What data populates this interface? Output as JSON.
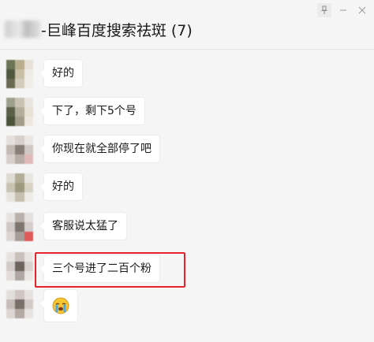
{
  "header": {
    "title": "-巨峰百度搜索祛斑 (7)"
  },
  "messages": [
    {
      "text": "好的"
    },
    {
      "text": "下了，剩下5个号"
    },
    {
      "text": "你现在就全部停了吧"
    },
    {
      "text": "好的"
    },
    {
      "text": "客服说太猛了"
    },
    {
      "text": "三个号进了二百个粉"
    },
    {
      "emoji": "crying-face-emoji"
    }
  ],
  "icons": {
    "pin": "pin-icon"
  },
  "colors": {
    "highlight_border": "#e8222b",
    "bubble": "#ffffff",
    "background": "#f5f5f5"
  }
}
